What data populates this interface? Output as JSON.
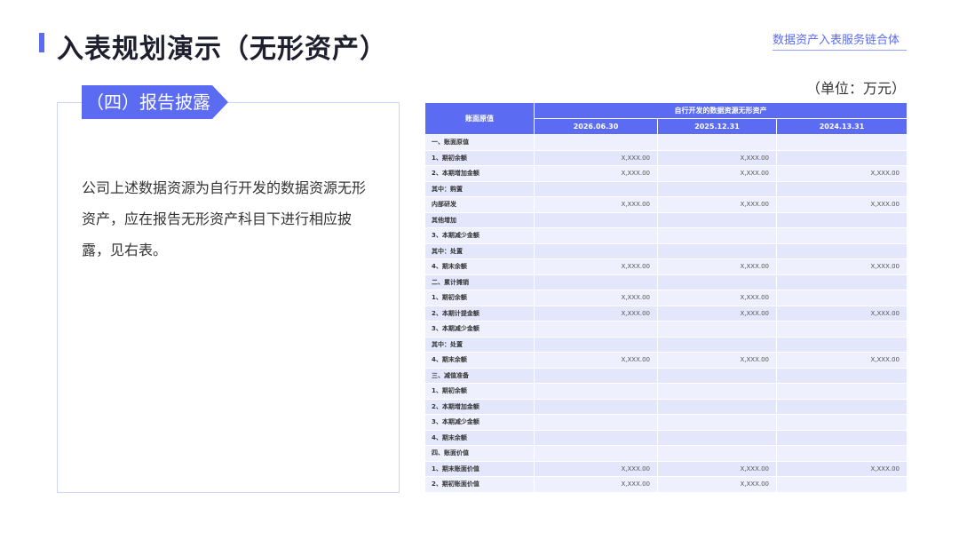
{
  "header": {
    "title": "入表规划演示（无形资产）",
    "brand": "数据资产入表服务链合体"
  },
  "unit_label": "（单位：万元）",
  "card": {
    "badge": "（四）报告披露",
    "description": "公司上述数据资源为自行开发的数据资源无形资产，应在报告无形资产科目下进行相应披露，见右表。"
  },
  "table": {
    "corner_header": "账面原值",
    "group_header": "自行开发的数据资源无形资产",
    "columns": [
      "2026.06.30",
      "2025.12.31",
      "2024.13.31"
    ],
    "rows": [
      {
        "label": "一、账面原值",
        "values": [
          "",
          "",
          ""
        ]
      },
      {
        "label": "1、期初余额",
        "values": [
          "X,XXX.00",
          "X,XXX.00",
          ""
        ]
      },
      {
        "label": "2、本期增加金额",
        "values": [
          "X,XXX.00",
          "X,XXX.00",
          "X,XXX.00"
        ]
      },
      {
        "label": "其中：购置",
        "values": [
          "",
          "",
          ""
        ]
      },
      {
        "label": "内部研发",
        "values": [
          "X,XXX.00",
          "X,XXX.00",
          "X,XXX.00"
        ]
      },
      {
        "label": "其他增加",
        "values": [
          "",
          "",
          ""
        ]
      },
      {
        "label": "3、本期减少金额",
        "values": [
          "",
          "",
          ""
        ]
      },
      {
        "label": "其中：处置",
        "values": [
          "",
          "",
          ""
        ]
      },
      {
        "label": "4、期末余额",
        "values": [
          "X,XXX.00",
          "X,XXX.00",
          "X,XXX.00"
        ]
      },
      {
        "label": "二、累计摊销",
        "values": [
          "",
          "",
          ""
        ]
      },
      {
        "label": "1、期初余额",
        "values": [
          "X,XXX.00",
          "X,XXX.00",
          ""
        ]
      },
      {
        "label": "2、本期计提金额",
        "values": [
          "X,XXX.00",
          "X,XXX.00",
          "X,XXX.00"
        ]
      },
      {
        "label": "3、本期减少金额",
        "values": [
          "",
          "",
          ""
        ]
      },
      {
        "label": "其中：处置",
        "values": [
          "",
          "",
          ""
        ]
      },
      {
        "label": "4、期末余额",
        "values": [
          "X,XXX.00",
          "X,XXX.00",
          "X,XXX.00"
        ]
      },
      {
        "label": "三、减值准备",
        "values": [
          "",
          "",
          ""
        ]
      },
      {
        "label": "1、期初余额",
        "values": [
          "",
          "",
          ""
        ]
      },
      {
        "label": "2、本期增加金额",
        "values": [
          "",
          "",
          ""
        ]
      },
      {
        "label": "3、本期减少金额",
        "values": [
          "",
          "",
          ""
        ]
      },
      {
        "label": "4、期末余额",
        "values": [
          "",
          "",
          ""
        ]
      },
      {
        "label": "四、账面价值",
        "values": [
          "",
          "",
          ""
        ]
      },
      {
        "label": "1、期末账面价值",
        "values": [
          "X,XXX.00",
          "X,XXX.00",
          "X,XXX.00"
        ]
      },
      {
        "label": "2、期初账面价值",
        "values": [
          "X,XXX.00",
          "X,XXX.00",
          ""
        ]
      }
    ]
  },
  "colors": {
    "accent": "#5b6cf2",
    "row_light": "#eef0fd",
    "row_dark": "#e4e7fc"
  }
}
